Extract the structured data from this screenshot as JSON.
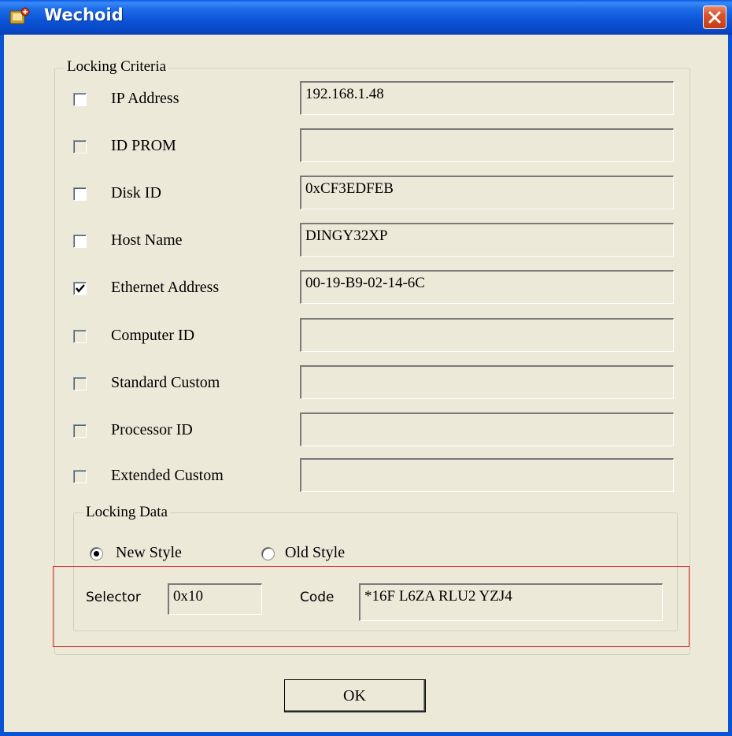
{
  "window": {
    "title": "Wechoid"
  },
  "locking_criteria": {
    "legend": "Locking Criteria",
    "items": [
      {
        "label": "IP Address",
        "checked": false,
        "enabled": true,
        "value": "192.168.1.48"
      },
      {
        "label": "ID PROM",
        "checked": false,
        "enabled": false,
        "value": ""
      },
      {
        "label": "Disk ID",
        "checked": false,
        "enabled": true,
        "value": "0xCF3EDFEB"
      },
      {
        "label": "Host Name",
        "checked": false,
        "enabled": true,
        "value": "DINGY32XP"
      },
      {
        "label": "Ethernet Address",
        "checked": true,
        "enabled": true,
        "value": "00-19-B9-02-14-6C"
      },
      {
        "label": "Computer ID",
        "checked": false,
        "enabled": false,
        "value": ""
      },
      {
        "label": "Standard Custom",
        "checked": false,
        "enabled": false,
        "value": ""
      },
      {
        "label": "Processor ID",
        "checked": false,
        "enabled": false,
        "value": ""
      },
      {
        "label": "Extended Custom",
        "checked": false,
        "enabled": false,
        "value": ""
      }
    ]
  },
  "locking_data": {
    "legend": "Locking Data",
    "new_style_label": "New Style",
    "old_style_label": "Old Style",
    "selected_style": "New Style",
    "selector_label": "Selector",
    "selector_value": "0x10",
    "code_label": "Code",
    "code_value": "*16F L6ZA RLU2 YZJ4"
  },
  "buttons": {
    "ok_label": "OK"
  },
  "colors": {
    "titlebar": "#0b53d6",
    "dialog_bg": "#ece9d8",
    "highlight": "#e02020",
    "close_button": "#d8532d"
  },
  "icons": [
    "app-icon",
    "close-icon",
    "checkmark-icon"
  ]
}
